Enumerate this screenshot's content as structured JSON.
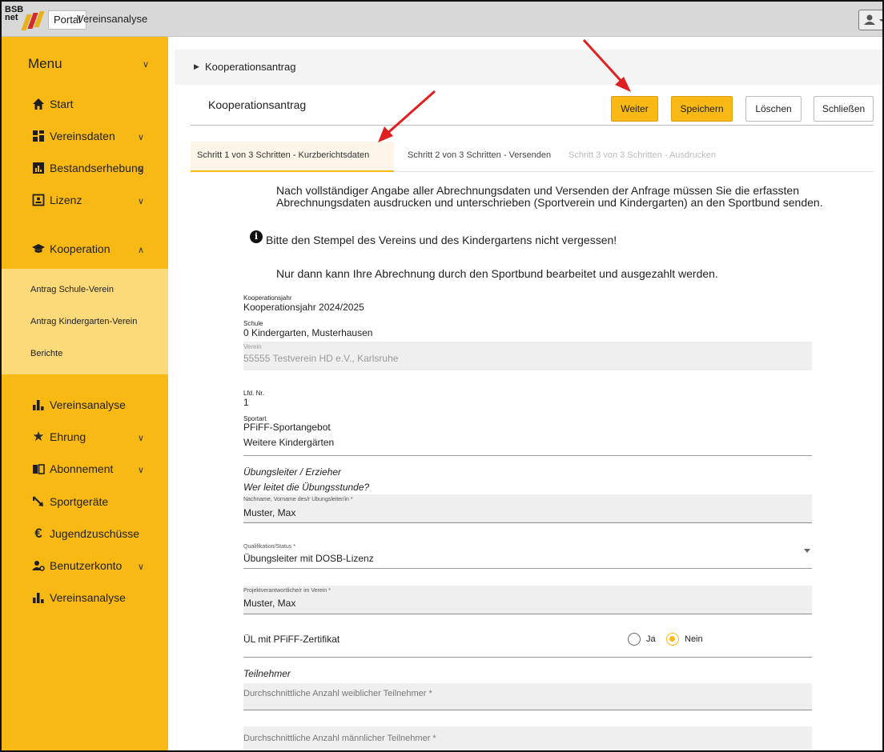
{
  "topbar": {
    "logo_text_1": "BSB",
    "logo_text_2": "net",
    "tab_portal": "Portal",
    "tab_app": "Vereinsanalyse"
  },
  "sidebar": {
    "menu_title": "Menu",
    "items": [
      {
        "label": "Start",
        "icon": "home-icon"
      },
      {
        "label": "Vereinsdaten",
        "icon": "grid-icon"
      },
      {
        "label": "Bestandserhebung",
        "icon": "chart-box-icon"
      },
      {
        "label": "Lizenz",
        "icon": "id-card-icon"
      },
      {
        "label": "Kooperation",
        "icon": "graduation-cap-icon"
      },
      {
        "label": "Vereinsanalyse",
        "icon": "bar-chart-icon"
      },
      {
        "label": "Ehrung",
        "icon": "star-icon"
      },
      {
        "label": "Abonnement",
        "icon": "book-icon"
      },
      {
        "label": "Sportgeräte",
        "icon": "arrow-icon"
      },
      {
        "label": "Jugendzuschüsse",
        "icon": "euro-icon"
      },
      {
        "label": "Benutzerkonto",
        "icon": "user-gear-icon"
      },
      {
        "label": "Vereinsanalyse",
        "icon": "bar-chart-icon"
      }
    ],
    "sub_items": [
      "Antrag Schule-Verein",
      "Antrag Kindergarten-Verein",
      "Berichte"
    ]
  },
  "content": {
    "breadcrumb": "Kooperationsantrag",
    "title": "Kooperationsantrag",
    "buttons": {
      "next": "Weiter",
      "save": "Speichern",
      "delete": "Löschen",
      "close": "Schließen"
    },
    "steps": [
      "Schritt 1 von 3 Schritten - Kurzberichtsdaten",
      "Schritt 2 von 3 Schritten - Versenden",
      "Schritt 3 von 3 Schritten - Ausdrucken"
    ],
    "info_line1": "Nach vollständiger Angabe aller Abrechnungsdaten und Versenden der Anfrage müssen Sie die erfassten",
    "info_line2": "Abrechnungsdaten ausdrucken und unterschrieben (Sportverein und Kindergarten) an den Sportbund senden.",
    "notice": "Bitte den Stempel des Vereins und des Kindergartens nicht vergessen!",
    "info_line3": "Nur dann kann Ihre Abrechnung durch den Sportbund bearbeitet und ausgezahlt werden.",
    "fields": {
      "year_label": "Kooperationsjahr",
      "year_value": "Kooperationsjahr 2024/2025",
      "school_label": "Schule",
      "school_value": "0 Kindergarten, Musterhausen",
      "club_label": "Verein",
      "club_value": "55555 Testverein HD e.V., Karlsruhe",
      "lfd_label": "Lfd. Nr.",
      "lfd_value": "1",
      "sport_label": "Sportart",
      "sport_value": "PFiFF-Sportangebot",
      "more_kg": "Weitere Kindergärten",
      "section_trainer": "Übungsleiter / Erzieher",
      "question_trainer": "Wer leitet die Übungsstunde?",
      "trainer_name_label": "Nachname, Vorname des/r Ubungsleiter/in *",
      "trainer_name_value": "Muster, Max",
      "qual_label": "Qualifikation/Status *",
      "qual_value": "Übungsleiter mit DOSB-Lizenz",
      "proj_label": "Projektverantwortliche/r im Verein *",
      "proj_value": "Muster, Max",
      "cert_label": "ÜL mit PFiFF-Zertifikat",
      "radio_yes": "Ja",
      "radio_no": "Nein",
      "radio_selected": "Nein",
      "section_participants": "Teilnehmer",
      "female_placeholder": "Durchschnittliche Anzahl weiblicher Teilnehmer *",
      "male_placeholder": "Durchschnittliche Anzahl männlicher Teilnehmer *"
    }
  },
  "colors": {
    "sidebar": "#f9b914",
    "sub_panel": "#fcd979",
    "accent": "#f9b914",
    "annotation_arrow": "#e02020"
  }
}
